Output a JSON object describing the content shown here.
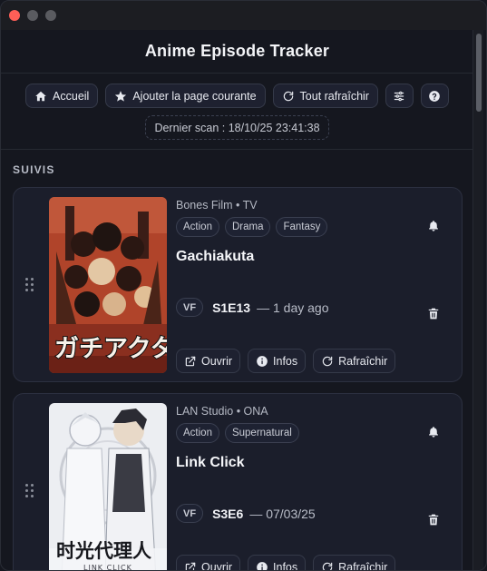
{
  "app": {
    "title": "Anime Episode Tracker"
  },
  "toolbar": {
    "home_label": "Accueil",
    "add_label": "Ajouter la page courante",
    "refresh_all_label": "Tout rafraîchir"
  },
  "scan": {
    "text": "Dernier scan : 18/10/25 23:41:38"
  },
  "section": {
    "label": "SUIVIS"
  },
  "cards": [
    {
      "studio": "Bones Film • TV",
      "tags": [
        "Action",
        "Drama",
        "Fantasy"
      ],
      "title": "Gachiakuta",
      "lang": "VF",
      "episode": "S1E13",
      "when": "— 1 day ago",
      "poster_text": "ガチアクタ",
      "open_label": "Ouvrir",
      "info_label": "Infos",
      "refresh_label": "Rafraîchir"
    },
    {
      "studio": "LAN Studio • ONA",
      "tags": [
        "Action",
        "Supernatural"
      ],
      "title": "Link Click",
      "lang": "VF",
      "episode": "S3E6",
      "when": "— 07/03/25",
      "poster_text": "时光代理人",
      "poster_subtext": "LINK CLICK",
      "open_label": "Ouvrir",
      "info_label": "Infos",
      "refresh_label": "Rafraîchir"
    }
  ],
  "colors": {
    "background": "#15171f",
    "card": "#1b1e2b",
    "close": "#ff5f57",
    "poster1_bg": "#b0442a"
  }
}
